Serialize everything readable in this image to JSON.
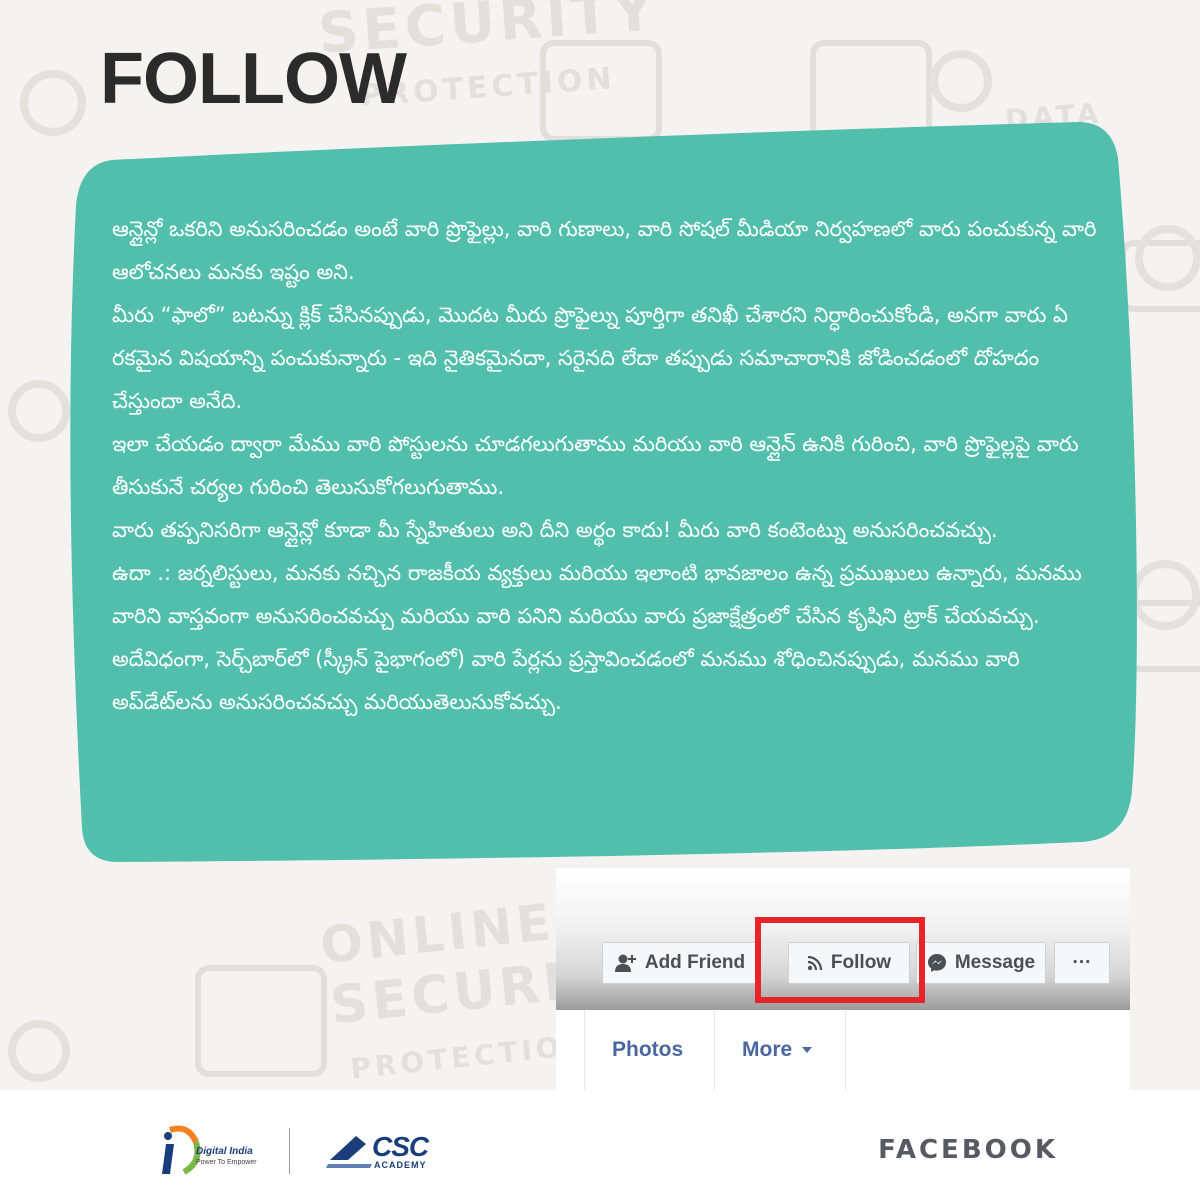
{
  "title": "FOLLOW",
  "paragraphs": [
    "ఆన్లైన్లో ఒకరిని అనుసరించడం అంటే వారి ప్రొఫైల్లు, వారి గుణాలు, వారి సోషల్ మీడియా నిర్వహణలో వారు పంచుకున్న వారి ఆలోచనలు మనకు ఇష్టం అని.",
    "మీరు “ఫాలో” బటన్ను క్లిక్ చేసినప్పుడు, మొదట మీరు ప్రొఫైల్ను పూర్తిగా తనిఖీ చేశారని నిర్ధారించుకోండి, అనగా వారు ఏ రకమైన విషయాన్ని పంచుకున్నారు - ఇది నైతికమైనదా, సరైనది లేదా తప్పుడు సమాచారానికి జోడించడంలో దోహదం చేస్తుందా అనేది.",
    "ఇలా చేయడం ద్వారా మేము వారి పోస్టులను చూడగలుగుతాము మరియు వారి ఆన్లైన్ ఉనికి గురించి, వారి ప్రొఫైల్లపై వారు తీసుకునే చర్యల గురించి తెలుసుకోగలుగుతాము.",
    "వారు తప్పనిసరిగా ఆన్లైన్లో కూడా మీ స్నేహితులు అని దీని అర్థం కాదు! మీరు వారి కంటెంట్ను అనుసరించవచ్చు.",
    "ఉదా .: జర్నలిస్టులు, మనకు నచ్చిన రాజకీయ వ్యక్తులు మరియు ఇలాంటి భావజాలం ఉన్న ప్రముఖులు ఉన్నారు, మనము వారిని వాస్తవంగా అనుసరించవచ్చు మరియు వారి పనిని మరియు వారు ప్రజాక్షేత్రంలో చేసిన కృషిని ట్రాక్ చేయవచ్చు. అదేవిధంగా, సెర్చ్‌బార్‌లో (స్క్రీన్ పైభాగంలో) వారి పేర్లను ప్రస్తావించడంలో మనము శోధించినప్పుడు, మనము వారి అప్‌డేట్‌లను అనుసరించవచ్చు మరియుతెలుసుకోవచ్చు."
  ],
  "facebook_ui": {
    "buttons": {
      "add_friend": "Add Friend",
      "follow": "Follow",
      "message": "Message",
      "more_dots": "···"
    },
    "tabs": {
      "photos": "Photos",
      "more": "More"
    }
  },
  "footer": {
    "digital_india_name": "Digital India",
    "digital_india_tagline": "Power To Empower",
    "csc_name": "CSC",
    "csc_sub": "ACADEMY",
    "brand": "FACEBOOK"
  },
  "background_words": [
    "SECURITY",
    "PROTECTION",
    "DATA",
    "ONLINE",
    "SECURITY",
    "PROTECTION"
  ],
  "colors": {
    "blob": "#52bfac",
    "highlight": "#e5242c",
    "fb_link": "#4b67a1"
  }
}
